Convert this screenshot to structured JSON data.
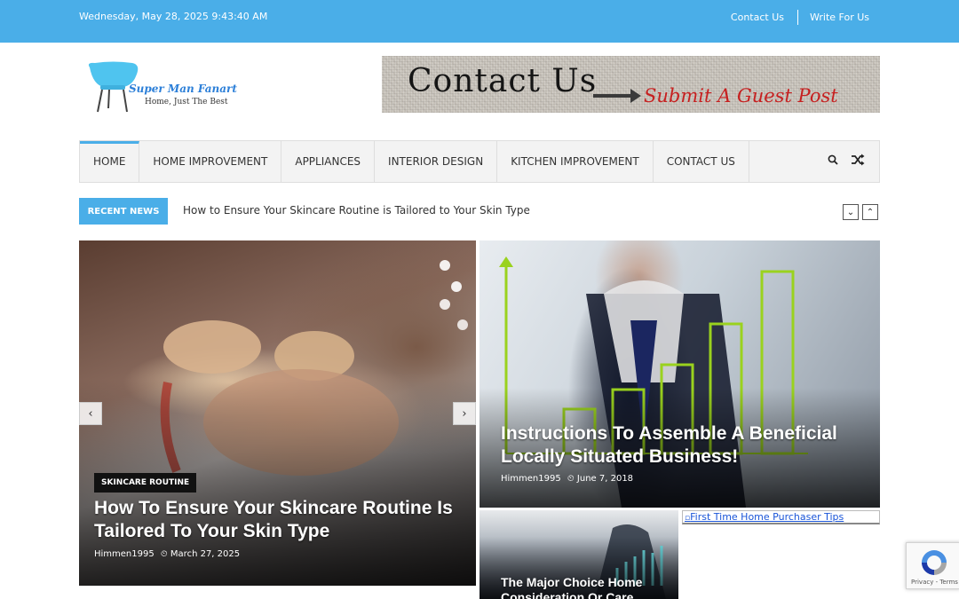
{
  "topbar": {
    "date": "Wednesday, May 28, 2025 9:43:40 AM",
    "links": [
      "Contact Us",
      "Write For Us"
    ]
  },
  "header": {
    "logo_name": "Super Man Fanart",
    "logo_tagline": "Home, Just The Best",
    "banner_main": "Contact Us",
    "banner_sub": "Submit A Guest Post"
  },
  "nav": {
    "items": [
      "HOME",
      "HOME IMPROVEMENT",
      "APPLIANCES",
      "INTERIOR DESIGN",
      "KITCHEN IMPROVEMENT",
      "CONTACT US"
    ],
    "search_icon": "search-icon",
    "random_icon": "shuffle-icon"
  },
  "ticker": {
    "label": "RECENT NEWS",
    "headline": "How to Ensure Your Skincare Routine is Tailored to Your Skin Type",
    "down_glyph": "⌄",
    "up_glyph": "⌃"
  },
  "slider": {
    "category": "SKINCARE ROUTINE",
    "title": "How To Ensure Your Skincare Routine Is Tailored To Your Skin Type",
    "author": "Himmen1995",
    "date": "March 27, 2025",
    "prev_glyph": "‹",
    "next_glyph": "›"
  },
  "right_post": {
    "title": "Instructions To Assemble A Beneficial Locally Situated Business!",
    "author": "Himmen1995",
    "date": "June 7, 2018"
  },
  "small_post": {
    "title": "The Major Choice Home Consideration Or Care Home"
  },
  "broken_post": {
    "alt": "First Time Home Purchaser Tips"
  },
  "recaptcha": {
    "caption": "Privacy - Terms"
  },
  "colors": {
    "accent": "#4aaee8",
    "chart_green": "#9ad21e"
  }
}
